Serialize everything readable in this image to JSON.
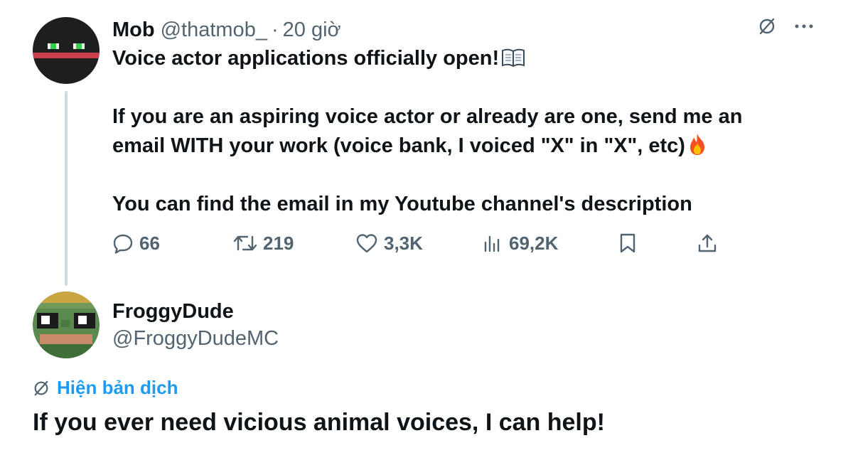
{
  "tweet": {
    "author": {
      "display_name": "Mob",
      "handle": "@thatmob_",
      "avatar_icon": "black-circle-avatar-with-green-eyes-red-band"
    },
    "separator": "·",
    "time": "20 giờ",
    "top_icons": [
      "translate-off-icon",
      "more-options-icon"
    ],
    "lines": {
      "line1": "Voice actor applications officially open!",
      "line1_emoji": "open-book-emoji",
      "line2": "If you are an aspiring voice actor or already are one, send me an",
      "line3": "email WITH your work (voice bank, I voiced \"X\" in \"X\", etc)",
      "line3_emoji": "fire-emoji",
      "line4": "You can find the email in my Youtube channel's description"
    },
    "actions": {
      "replies": "66",
      "retweets": "219",
      "likes": "3,3K",
      "views": "69,2K",
      "icons": [
        "reply-icon",
        "retweet-icon",
        "like-icon",
        "views-icon",
        "bookmark-icon",
        "share-icon"
      ]
    }
  },
  "reply": {
    "author": {
      "display_name": "FroggyDude",
      "handle": "@FroggyDudeMC",
      "avatar_icon": "pixel-frog-avatar"
    },
    "translate_label": "Hiện bản dịch",
    "text": "If you ever need vicious animal voices, I can help!"
  },
  "colors": {
    "text_primary": "#0f1419",
    "text_secondary": "#536471",
    "accent": "#1d9bf0",
    "thread_line": "#cfd9de"
  }
}
